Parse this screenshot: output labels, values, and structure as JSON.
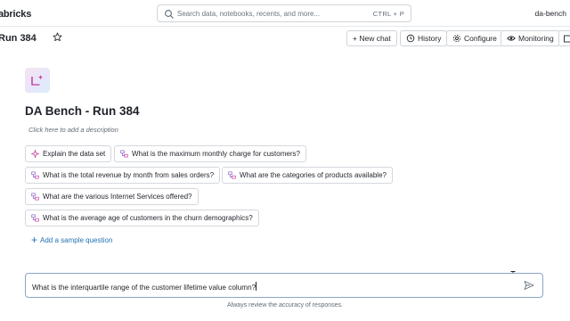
{
  "app": {
    "brand": "abricks",
    "workspace": "da-bench"
  },
  "search": {
    "placeholder": "Search data, notebooks, recents, and more...",
    "shortcut": "CTRL + P"
  },
  "header": {
    "title": "Run 384",
    "buttons": {
      "new_chat": "+ New chat",
      "history": "History",
      "configure": "Configure",
      "monitoring": "Monitoring"
    }
  },
  "room": {
    "title": "DA Bench - Run 384",
    "description_placeholder": "Click here to add a description"
  },
  "sample_questions": [
    {
      "label": "Explain the data set",
      "icon": "sparkle-icon"
    },
    {
      "label": "What is the maximum monthly charge for customers?",
      "icon": "genie-icon"
    },
    {
      "label": "What is the total revenue by month from sales orders?",
      "icon": "genie-icon"
    },
    {
      "label": "What are the categories of products available?",
      "icon": "genie-icon"
    },
    {
      "label": "What are the various Internet Services offered?",
      "icon": "genie-icon"
    },
    {
      "label": "What is the average age of customers in the churn demographics?",
      "icon": "genie-icon"
    }
  ],
  "add_sample_question": "Add a sample question",
  "chat_input": {
    "value": "What is the interquartile range of the customer lifetime value column?"
  },
  "disclaimer": "Always review the accuracy of responses.",
  "colors": {
    "link": "#2272b4",
    "accent_pink": "#c43ea0",
    "border": "#d3d8de"
  }
}
